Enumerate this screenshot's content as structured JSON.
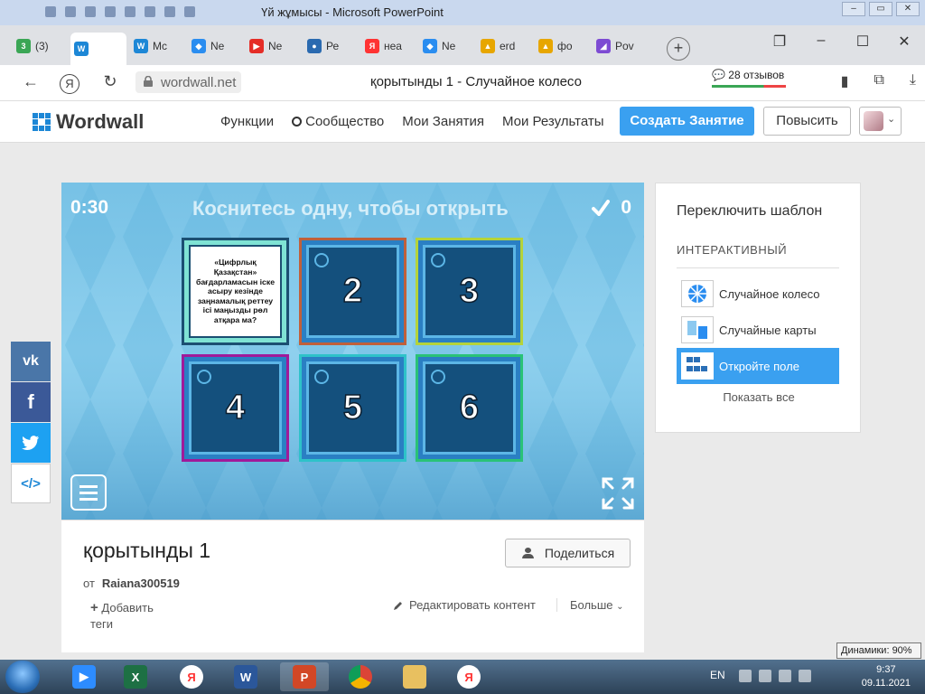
{
  "ppt": {
    "title": "Үй жұмысы - Microsoft PowerPoint"
  },
  "browser": {
    "tabs": [
      {
        "label": "(3)",
        "color": "#3aa655",
        "glyph": "3"
      },
      {
        "label": "",
        "color": "#1d87d6",
        "glyph": "W"
      },
      {
        "label": "Mc",
        "color": "#1d87d6",
        "glyph": "W"
      },
      {
        "label": "Ne",
        "color": "#2a8df0",
        "glyph": "◆"
      },
      {
        "label": "Ne",
        "color": "#e52d27",
        "glyph": "▶"
      },
      {
        "label": "Ре",
        "color": "#2a6ab0",
        "glyph": "●"
      },
      {
        "label": "неа",
        "color": "#f33",
        "glyph": "Я"
      },
      {
        "label": "Ne",
        "color": "#2a8df0",
        "glyph": "◆"
      },
      {
        "label": "erd",
        "color": "#e7a600",
        "glyph": "▲"
      },
      {
        "label": "фо",
        "color": "#e7a600",
        "glyph": "▲"
      },
      {
        "label": "Pov",
        "color": "#7d4bd3",
        "glyph": "◢"
      }
    ],
    "domain": "wordwall.net",
    "page_title": "қорытынды 1 - Случайное колесо",
    "reviews": "28 отзывов"
  },
  "site": {
    "logo_text": "Wordwall",
    "menu": [
      "Функции",
      "Сообщество",
      "Мои Занятия",
      "Мои Результаты"
    ],
    "create_label": "Создать Занятие",
    "upgrade_label": "Повысить"
  },
  "game": {
    "timer": "0:30",
    "instruction": "Коснитесь одну, чтобы открыть",
    "score": "0",
    "open_text": "«Цифрлық Қазақстан» бағдарламасын іске асыру кезінде заңнамалық реттеу ісі маңызды рөл атқара ма?",
    "boxes": [
      {
        "label": "2",
        "border": "#c0603a"
      },
      {
        "label": "3",
        "border": "#b5d33a"
      },
      {
        "label": "4",
        "border": "#a01a9a"
      },
      {
        "label": "5",
        "border": "#2ec2c9"
      },
      {
        "label": "6",
        "border": "#2ac277"
      }
    ]
  },
  "activity": {
    "title": "қорытынды 1",
    "share_label": "Поделиться",
    "author_prefix": "от",
    "author": "Raiana300519",
    "add_tags": "Добавить теги",
    "edit_label": "Редактировать контент",
    "more_label": "Больше"
  },
  "templates": {
    "title": "Переключить шаблон",
    "section": "ИНТЕРАКТИВНЫЙ",
    "items": [
      "Случайное колесо",
      "Случайные карты",
      "Откройте поле"
    ],
    "show_all": "Показать все"
  },
  "social": [
    {
      "name": "vk",
      "glyph": "vk",
      "color": "#4a76a8"
    },
    {
      "name": "facebook",
      "glyph": "f",
      "color": "#3b5998"
    },
    {
      "name": "twitter",
      "glyph": "t",
      "color": "#1da1f2"
    },
    {
      "name": "embed",
      "glyph": "</>",
      "color": "#fff"
    }
  ],
  "taskbar": {
    "lang": "EN",
    "time": "9:37",
    "date": "09.11.2021",
    "volume_tip": "Динамики: 90%"
  }
}
